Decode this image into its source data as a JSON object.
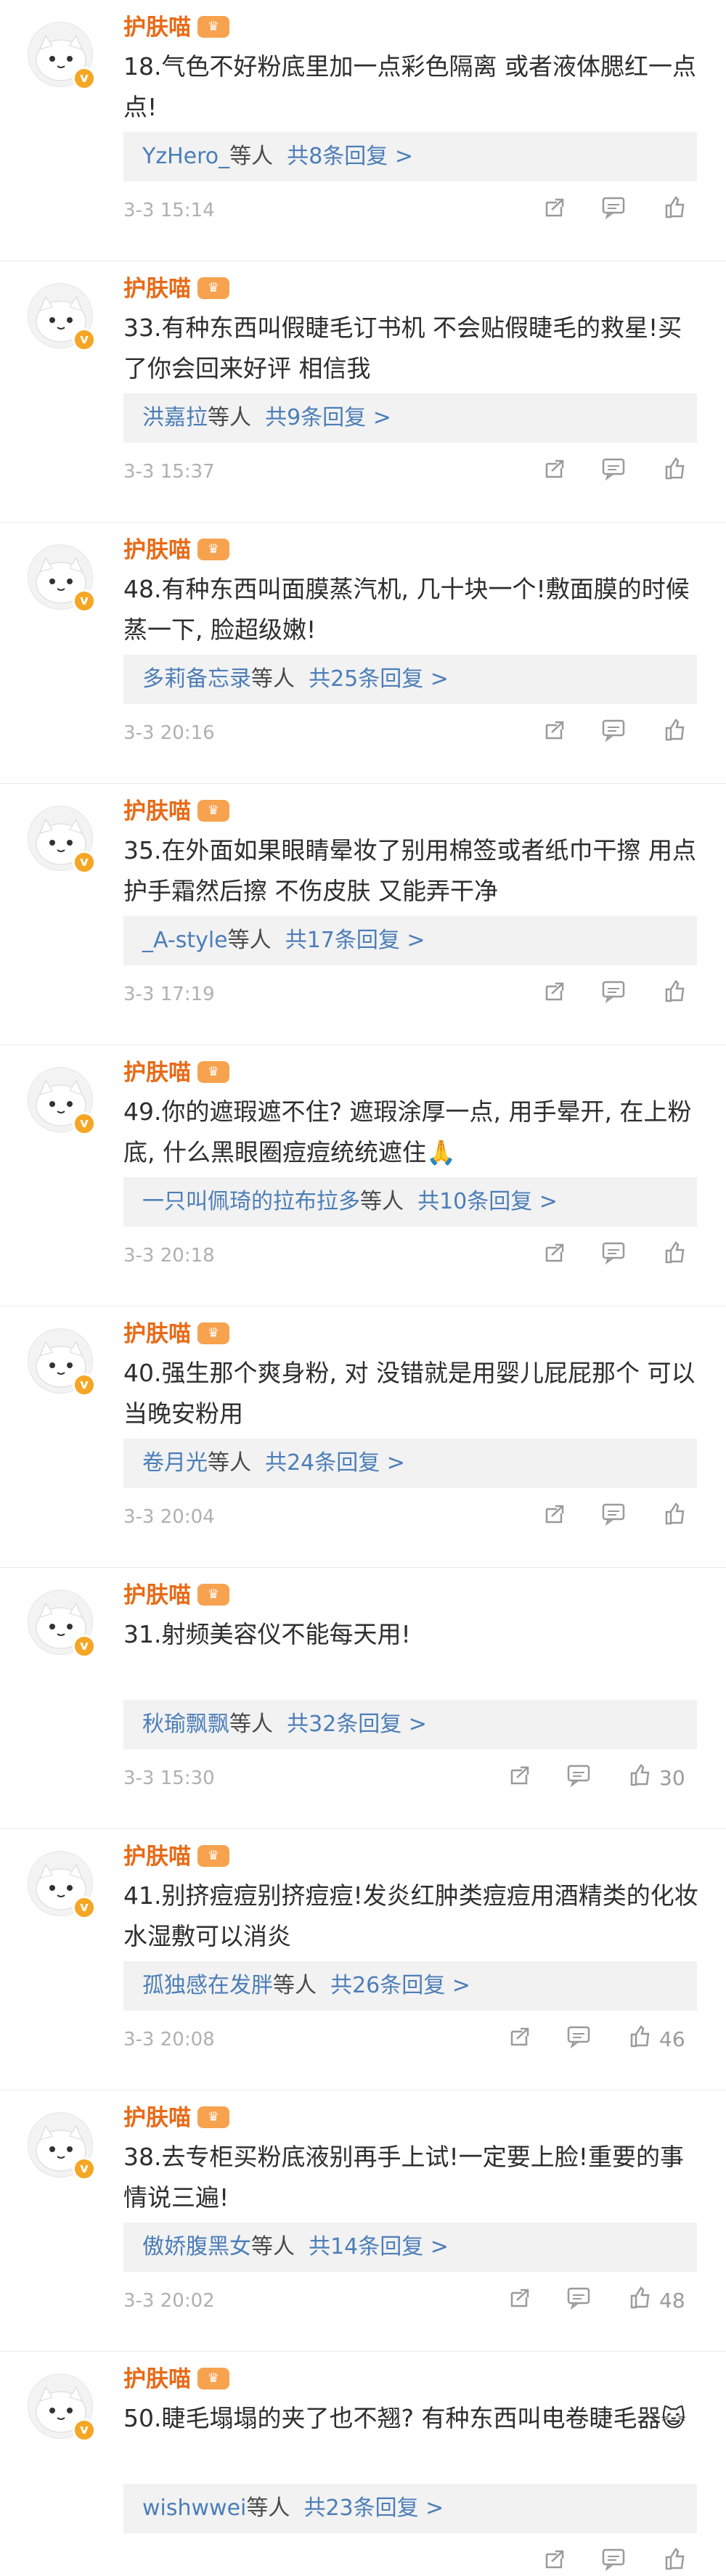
{
  "icons": {
    "share": "share-icon",
    "comment": "comment-icon",
    "like": "like-icon",
    "avatar_mascot": "cat-avatar",
    "verified": "verified-badge"
  },
  "colors": {
    "name": "#e86a17",
    "link": "#4c7eb8",
    "reply_bg": "#f2f2f2",
    "meta": "#b0b0b0"
  },
  "comments": [
    {
      "author": "护肤喵",
      "text": "18.气色不好粉底里加一点彩色隔离 或者液体腮红一点点!",
      "replier": "YzHero_",
      "reply_suffix": "等人",
      "reply_count": "共8条回复 >",
      "time": "3-3 15:14",
      "likes": ""
    },
    {
      "author": "护肤喵",
      "text": "33.有种东西叫假睫毛订书机 不会贴假睫毛的救星!买了你会回来好评 相信我",
      "replier": "洪嘉拉",
      "reply_suffix": "等人",
      "reply_count": "共9条回复 >",
      "time": "3-3 15:37",
      "likes": ""
    },
    {
      "author": "护肤喵",
      "text": "48.有种东西叫面膜蒸汽机, 几十块一个!敷面膜的时候蒸一下, 脸超级嫩!",
      "replier": "多莉备忘录",
      "reply_suffix": "等人",
      "reply_count": "共25条回复 >",
      "time": "3-3 20:16",
      "likes": ""
    },
    {
      "author": "护肤喵",
      "text": "35.在外面如果眼睛晕妆了别用棉签或者纸巾干擦 用点护手霜然后擦 不伤皮肤 又能弄干净",
      "replier": "_A-style",
      "reply_suffix": "等人",
      "reply_count": "共17条回复 >",
      "time": "3-3 17:19",
      "likes": ""
    },
    {
      "author": "护肤喵",
      "text": "49.你的遮瑕遮不住? 遮瑕涂厚一点, 用手晕开, 在上粉底, 什么黑眼圈痘痘统统遮住🙏",
      "replier": "一只叫佩琦的拉布拉多",
      "reply_suffix": "等人",
      "reply_count": "共10条回复 >",
      "time": "3-3 20:18",
      "likes": ""
    },
    {
      "author": "护肤喵",
      "text": "40.强生那个爽身粉, 对 没错就是用婴儿屁屁那个 可以当晚安粉用",
      "replier": "卷月光",
      "reply_suffix": "等人",
      "reply_count": "共24条回复 >",
      "time": "3-3 20:04",
      "likes": ""
    },
    {
      "author": "护肤喵",
      "text": "31.射频美容仪不能每天用!",
      "replier": "秋瑜飘飘",
      "reply_suffix": "等人",
      "reply_count": "共32条回复 >",
      "time": "3-3 15:30",
      "likes": "30"
    },
    {
      "author": "护肤喵",
      "text": "41.别挤痘痘别挤痘痘!发炎红肿类痘痘用酒精类的化妆水湿敷可以消炎",
      "replier": "孤独感在发胖",
      "reply_suffix": "等人",
      "reply_count": "共26条回复 >",
      "time": "3-3 20:08",
      "likes": "46"
    },
    {
      "author": "护肤喵",
      "text": "38.去专柜买粉底液别再手上试!一定要上脸!重要的事情说三遍!",
      "replier": "傲娇腹黑女",
      "reply_suffix": "等人",
      "reply_count": "共14条回复 >",
      "time": "3-3 20:02",
      "likes": "48"
    },
    {
      "author": "护肤喵",
      "text": "50.睫毛塌塌的夹了也不翘? 有种东西叫电卷睫毛器😺",
      "replier": "wishwwei",
      "reply_suffix": "等人",
      "reply_count": "共23条回复 >",
      "time": "",
      "likes": ""
    }
  ]
}
